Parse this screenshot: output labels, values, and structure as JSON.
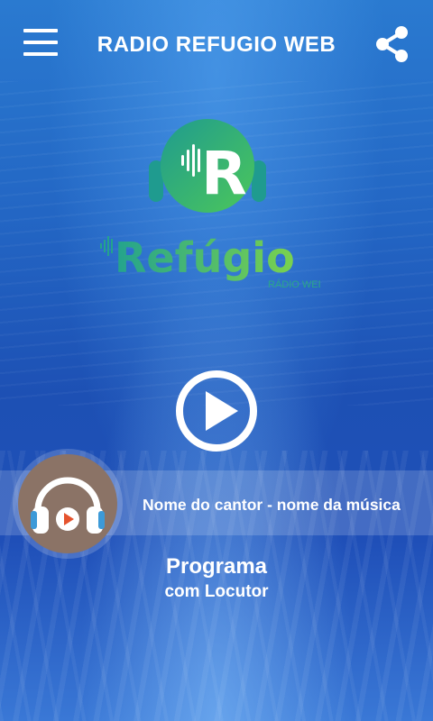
{
  "header": {
    "title": "RADIO REFUGIO WEB",
    "menu_icon": "hamburger-menu-icon",
    "share_icon": "share-icon"
  },
  "logo": {
    "letter": "R",
    "wordmark": "Refúgio",
    "tagline": "RÁDIO WEB",
    "colors": {
      "teal": "#1f9b8f",
      "green": "#3fc25a",
      "lime": "#6fd24a"
    }
  },
  "player": {
    "play_icon": "play-icon",
    "now_playing": "Nome do cantor - nome da música",
    "cover_icon": "headphones-icon"
  },
  "program": {
    "name": "Programa",
    "host": "com Locutor"
  },
  "colors": {
    "background": "#1f56b8",
    "text": "#ffffff",
    "cover": "#8b7366"
  }
}
